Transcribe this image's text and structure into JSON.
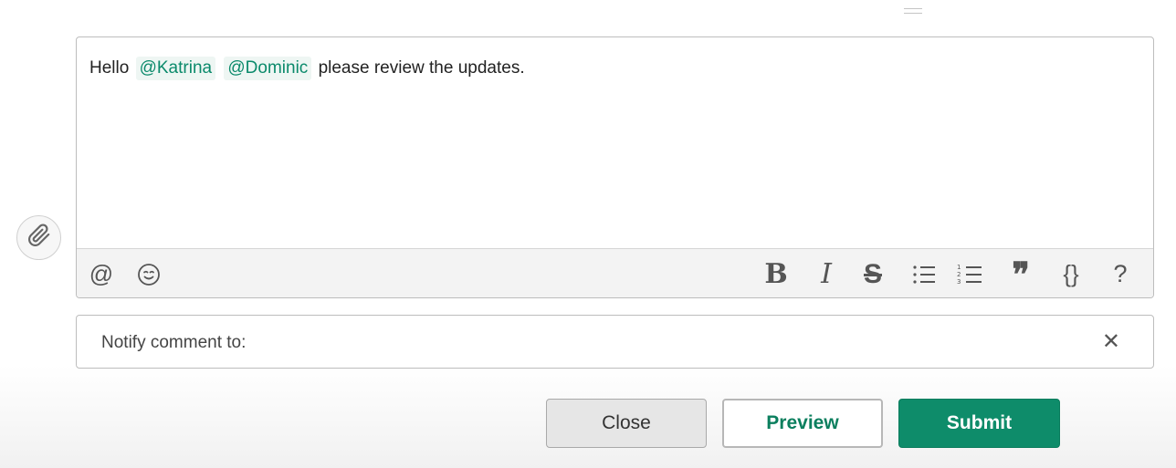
{
  "editor": {
    "text_before": "Hello",
    "mentions": [
      "@Katrina",
      "@Dominic"
    ],
    "text_after": "please review the updates."
  },
  "toolbar": {
    "left_tools": [
      {
        "icon": "at-icon",
        "glyph": "@"
      },
      {
        "icon": "emoji-icon"
      }
    ],
    "format_tools": [
      {
        "icon": "bold-icon",
        "glyph": "B"
      },
      {
        "icon": "italic-icon",
        "glyph": "I"
      },
      {
        "icon": "strikethrough-icon",
        "glyph": "S"
      },
      {
        "icon": "bullet-list-icon"
      },
      {
        "icon": "numbered-list-icon"
      },
      {
        "icon": "quote-icon",
        "glyph": "❞"
      },
      {
        "icon": "code-icon",
        "glyph": "{}"
      },
      {
        "icon": "help-icon",
        "glyph": "?"
      }
    ]
  },
  "notify": {
    "label": "Notify comment to:",
    "value": "",
    "clear_glyph": "✕"
  },
  "buttons": {
    "close": "Close",
    "preview": "Preview",
    "submit": "Submit"
  },
  "colors": {
    "accent": "#0e8c6a",
    "mention_text": "#0b8a6b",
    "mention_bg": "#eef6f3"
  }
}
